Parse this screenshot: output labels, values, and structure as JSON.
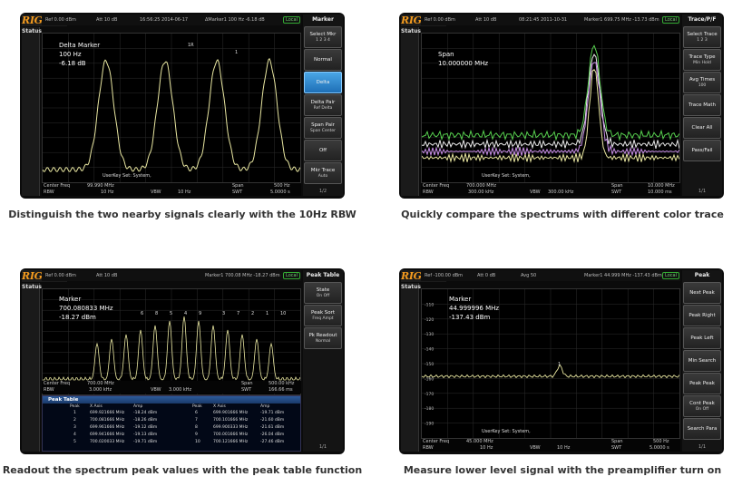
{
  "panels": [
    {
      "logo": "RIGOL",
      "status_label": "Status",
      "timestamp": "16:56:25 2014-06-17",
      "local": "Local",
      "top_left": "Ref 0.00 dBm",
      "top_att": "Att 10 dB",
      "top_marker": "ΔMarker1 100 Hz -6.18 dB",
      "marker_title": "Delta Marker",
      "marker_line1": "100 Hz",
      "marker_line2": "-6.18 dB",
      "marker_tags": [
        "1R",
        "1"
      ],
      "userkey": "UserKey Set:  System,",
      "bottom": {
        "center_label": "Center Freq",
        "center_val": "99.990 MHz",
        "rbw_label": "RBW",
        "rbw_val": "10 Hz",
        "vbw_label": "VBW",
        "vbw_val": "10 Hz",
        "span_label": "Span",
        "span_val": "500 Hz",
        "swt_label": "SWT",
        "swt_val": "5.0000 s"
      },
      "menu": {
        "title": "Marker",
        "items": [
          {
            "label": "Select Mkr",
            "sub": "1 2 3 4"
          },
          {
            "label": "Normal",
            "sub": ""
          },
          {
            "label": "Delta",
            "sub": "",
            "active": true
          },
          {
            "label": "Delta Pair",
            "sub": "Ref  Delta"
          },
          {
            "label": "Span Pair",
            "sub": "Span  Center"
          },
          {
            "label": "Off",
            "sub": ""
          },
          {
            "label": "Mkr Trace",
            "sub": "Auto"
          }
        ],
        "page": "1/2"
      },
      "caption": "Distinguish the two nearby signals clearly with the 10Hz RBW"
    },
    {
      "logo": "RIGOL",
      "status_label": "Status",
      "timestamp": "08:21:45 2011-10-31",
      "local": "Local",
      "top_left": "Ref 0.00 dBm",
      "top_att": "Att 10 dB",
      "top_marker": "Marker1 699.75 MHz -13.73 dBm",
      "marker_title": "Span",
      "marker_line1": "10.000000 MHz",
      "marker_line2": "",
      "marker_tags": [],
      "userkey": "UserKey Set:  System,",
      "bottom": {
        "center_label": "Center Freq",
        "center_val": "700.000 MHz",
        "rbw_label": "RBW",
        "rbw_val": "300.00 kHz",
        "vbw_label": "VBW",
        "vbw_val": "300.00 kHz",
        "span_label": "Span",
        "span_val": "10.000 MHz",
        "swt_label": "SWT",
        "swt_val": "10.000 ms"
      },
      "menu": {
        "title": "Trace/P/F",
        "items": [
          {
            "label": "Select Trace",
            "sub": "1 2 3"
          },
          {
            "label": "Trace Type",
            "sub": "Min Hold"
          },
          {
            "label": "Avg Times",
            "sub": "100"
          },
          {
            "label": "Trace Math",
            "sub": ""
          },
          {
            "label": "Clear All",
            "sub": ""
          },
          {
            "label": "Pass/Fail",
            "sub": ""
          }
        ],
        "page": "1/1"
      },
      "caption": "Quickly compare the spectrums with different color trace"
    },
    {
      "logo": "RIGOL",
      "status_label": "Status",
      "timestamp": "",
      "local": "Local",
      "top_left": "Ref 0.00 dBm",
      "top_att": "Att 10 dB",
      "top_marker": "Marker1 700.08 MHz -18.27 dBm",
      "marker_title": "Marker",
      "marker_line1": "700.080833 MHz",
      "marker_line2": "-18.27 dBm",
      "marker_tags": [
        "6",
        "8",
        "5",
        "4",
        "9",
        "3",
        "7",
        "2",
        "1",
        "10"
      ],
      "userkey": "",
      "bottom": {
        "center_label": "Center Freq",
        "center_val": "700.00 MHz",
        "rbw_label": "RBW",
        "rbw_val": "3.000 kHz",
        "vbw_label": "VBW",
        "vbw_val": "3.000 kHz",
        "span_label": "Span",
        "span_val": "500.00 kHz",
        "swt_label": "SWT",
        "swt_val": "166.66 ms"
      },
      "menu": {
        "title": "Peak Table",
        "items": [
          {
            "label": "State",
            "sub": "On  Off"
          },
          {
            "label": "Peak Sort",
            "sub": "Freq  Ampt"
          },
          {
            "label": "Pk Readout",
            "sub": "Normal"
          }
        ],
        "page": "1/1"
      },
      "peak_table": {
        "title": "Peak Table",
        "headers": [
          "Peak",
          "X Axis",
          "Amp",
          "Peak",
          "X Axis",
          "Amp"
        ],
        "rows": [
          [
            "1",
            "699.921666 MHz",
            "-18.24 dBm",
            "6",
            "699.901666 MHz",
            "-19.71 dBm"
          ],
          [
            "2",
            "700.081666 MHz",
            "-18.26 dBm",
            "7",
            "700.101666 MHz",
            "-21.60 dBm"
          ],
          [
            "3",
            "699.961666 MHz",
            "-19.12 dBm",
            "8",
            "699.900333 MHz",
            "-21.61 dBm"
          ],
          [
            "4",
            "699.941666 MHz",
            "-19.13 dBm",
            "9",
            "700.001666 MHz",
            "-26.04 dBm"
          ],
          [
            "5",
            "700.020033 MHz",
            "-19.71 dBm",
            "10",
            "700.121666 MHz",
            "-27.46 dBm"
          ]
        ]
      },
      "caption": "Readout the spectrum peak values with the peak table function"
    },
    {
      "logo": "RIGOL",
      "status_label": "Status",
      "timestamp": "08:59:45 2014-06-18",
      "local": "Local",
      "top_left": "Ref -100.00 dBm",
      "top_att": "Att 0 dB",
      "top_avg": "Avg 50",
      "top_marker": "Marker1 44.999 MHz -137.43 dBm",
      "marker_title": "Marker",
      "marker_line1": "44.999996 MHz",
      "marker_line2": "-137.43 dBm",
      "marker_tags": [
        "1"
      ],
      "yticks": [
        "-110",
        "-120",
        "-130",
        "-140",
        "-150",
        "-160",
        "-170",
        "-180",
        "-190"
      ],
      "userkey": "UserKey Set:  System,",
      "bottom": {
        "center_label": "Center Freq",
        "center_val": "45.000 MHz",
        "rbw_label": "RBW",
        "rbw_val": "10 Hz",
        "vbw_label": "VBW",
        "vbw_val": "10 Hz",
        "span_label": "Span",
        "span_val": "500 Hz",
        "swt_label": "SWT",
        "swt_val": "5.0000 s"
      },
      "menu": {
        "title": "Peak",
        "items": [
          {
            "label": "Next Peak",
            "sub": ""
          },
          {
            "label": "Peak Right",
            "sub": ""
          },
          {
            "label": "Peak Left",
            "sub": ""
          },
          {
            "label": "Min Search",
            "sub": ""
          },
          {
            "label": "Peak Peak",
            "sub": ""
          },
          {
            "label": "Cont Peak",
            "sub": "On  Off"
          },
          {
            "label": "Search Para",
            "sub": ""
          }
        ],
        "page": "1/1"
      },
      "caption": "Measure lower level signal with the preamplifier turn on"
    }
  ],
  "colors": {
    "trace_yellow": "#e8e6a0",
    "trace_green": "#57d04f",
    "trace_purple": "#c98fe8",
    "trace_white": "#e8e8e8",
    "accent_blue": "#2b7bc4",
    "logo_orange": "#f39a1e"
  }
}
